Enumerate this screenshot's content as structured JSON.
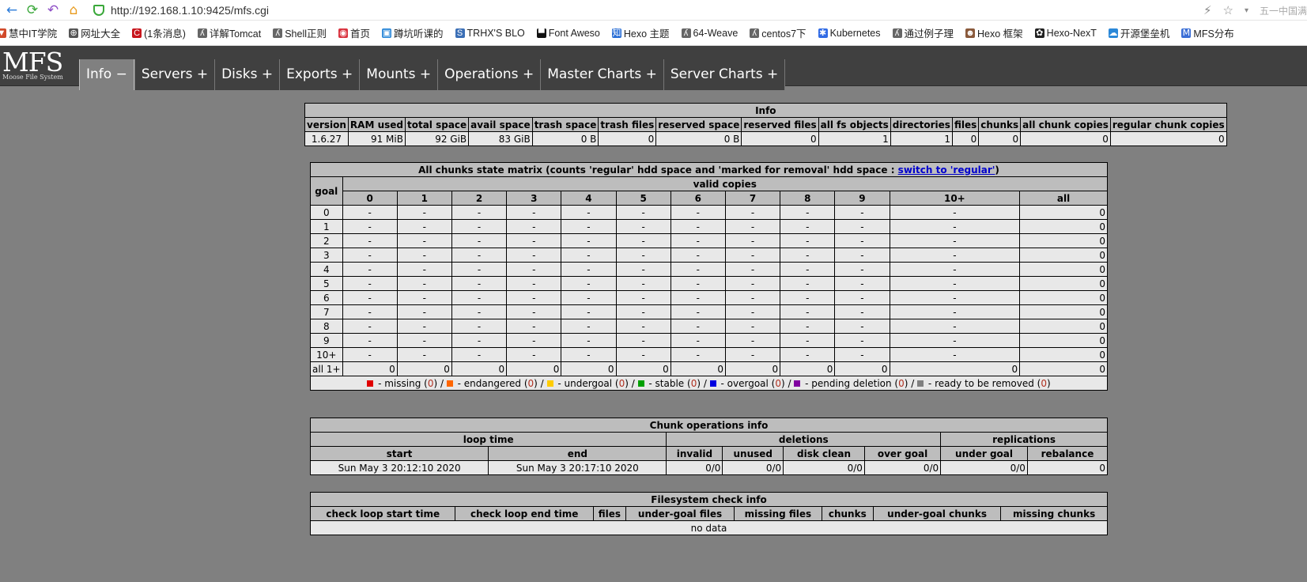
{
  "browser": {
    "url": "http://192.168.1.10:9425/mfs.cgi",
    "corner_text": "五一中国满"
  },
  "bookmarks": [
    {
      "label": "慧中IT学院",
      "color": "#d14a2b",
      "glyph": "▼"
    },
    {
      "label": "网址大全",
      "color": "#555555",
      "glyph": "⊕"
    },
    {
      "label": "(1条消息)",
      "color": "#c8161d",
      "glyph": "C"
    },
    {
      "label": "详解Tomcat",
      "color": "#666666",
      "glyph": "ʎ"
    },
    {
      "label": "Shell正则",
      "color": "#666666",
      "glyph": "ʎ"
    },
    {
      "label": "首页",
      "color": "#d9333f",
      "glyph": "◉"
    },
    {
      "label": "蹲坑听课的",
      "color": "#2b88d8",
      "glyph": "▣"
    },
    {
      "label": "TRHX'S BLO",
      "color": "#3b6fb6",
      "glyph": "S"
    },
    {
      "label": "Font Aweso",
      "color": "#111111",
      "glyph": "▀"
    },
    {
      "label": "Hexo 主题",
      "color": "#2a6fd6",
      "glyph": "知"
    },
    {
      "label": "64-Weave",
      "color": "#666666",
      "glyph": "ʎ"
    },
    {
      "label": "centos7下",
      "color": "#666666",
      "glyph": "ʎ"
    },
    {
      "label": "Kubernetes",
      "color": "#326ce5",
      "glyph": "✱"
    },
    {
      "label": "通过例子理",
      "color": "#666666",
      "glyph": "ʎ"
    },
    {
      "label": "Hexo 框架",
      "color": "#8a5a3c",
      "glyph": "☻"
    },
    {
      "label": "Hexo-NexT",
      "color": "#222222",
      "glyph": "✿"
    },
    {
      "label": "开源堡垒机",
      "color": "#2b88d8",
      "glyph": "☁"
    },
    {
      "label": "MFS分布",
      "color": "#3b6fd6",
      "glyph": "Ⅿ"
    }
  ],
  "logo": {
    "big": "MFS",
    "small": "Moose File System"
  },
  "menu": [
    "Info −",
    "Servers +",
    "Disks +",
    "Exports +",
    "Mounts +",
    "Operations +",
    "Master Charts +",
    "Server Charts +"
  ],
  "info": {
    "caption": "Info",
    "headers": [
      "version",
      "RAM used",
      "total space",
      "avail space",
      "trash space",
      "trash files",
      "reserved space",
      "reserved files",
      "all fs objects",
      "directories",
      "files",
      "chunks",
      "all chunk copies",
      "regular chunk copies"
    ],
    "values": [
      "1.6.27",
      "91 MiB",
      "92 GiB",
      "83 GiB",
      "0 B",
      "0",
      "0 B",
      "0",
      "1",
      "1",
      "0",
      "0",
      "0",
      "0"
    ]
  },
  "matrix": {
    "caption": "All chunks state matrix (counts 'regular' hdd space and 'marked for removal' hdd space : ",
    "switch_link": "switch to 'regular'",
    "caption_end": ")",
    "goal_header": "goal",
    "valid_header": "valid copies",
    "columns": [
      "0",
      "1",
      "2",
      "3",
      "4",
      "5",
      "6",
      "7",
      "8",
      "9",
      "10+",
      "all"
    ],
    "rows": [
      {
        "goal": "0",
        "cells": [
          "-",
          "-",
          "-",
          "-",
          "-",
          "-",
          "-",
          "-",
          "-",
          "-",
          "-",
          "0"
        ]
      },
      {
        "goal": "1",
        "cells": [
          "-",
          "-",
          "-",
          "-",
          "-",
          "-",
          "-",
          "-",
          "-",
          "-",
          "-",
          "0"
        ]
      },
      {
        "goal": "2",
        "cells": [
          "-",
          "-",
          "-",
          "-",
          "-",
          "-",
          "-",
          "-",
          "-",
          "-",
          "-",
          "0"
        ]
      },
      {
        "goal": "3",
        "cells": [
          "-",
          "-",
          "-",
          "-",
          "-",
          "-",
          "-",
          "-",
          "-",
          "-",
          "-",
          "0"
        ]
      },
      {
        "goal": "4",
        "cells": [
          "-",
          "-",
          "-",
          "-",
          "-",
          "-",
          "-",
          "-",
          "-",
          "-",
          "-",
          "0"
        ]
      },
      {
        "goal": "5",
        "cells": [
          "-",
          "-",
          "-",
          "-",
          "-",
          "-",
          "-",
          "-",
          "-",
          "-",
          "-",
          "0"
        ]
      },
      {
        "goal": "6",
        "cells": [
          "-",
          "-",
          "-",
          "-",
          "-",
          "-",
          "-",
          "-",
          "-",
          "-",
          "-",
          "0"
        ]
      },
      {
        "goal": "7",
        "cells": [
          "-",
          "-",
          "-",
          "-",
          "-",
          "-",
          "-",
          "-",
          "-",
          "-",
          "-",
          "0"
        ]
      },
      {
        "goal": "8",
        "cells": [
          "-",
          "-",
          "-",
          "-",
          "-",
          "-",
          "-",
          "-",
          "-",
          "-",
          "-",
          "0"
        ]
      },
      {
        "goal": "9",
        "cells": [
          "-",
          "-",
          "-",
          "-",
          "-",
          "-",
          "-",
          "-",
          "-",
          "-",
          "-",
          "0"
        ]
      },
      {
        "goal": "10+",
        "cells": [
          "-",
          "-",
          "-",
          "-",
          "-",
          "-",
          "-",
          "-",
          "-",
          "-",
          "-",
          "0"
        ]
      },
      {
        "goal": "all 1+",
        "cells": [
          "0",
          "0",
          "0",
          "0",
          "0",
          "0",
          "0",
          "0",
          "0",
          "0",
          "0",
          "0"
        ]
      }
    ],
    "legend": [
      {
        "color": "#e00000",
        "label": " - missing (",
        "count": "0",
        "sep": ") / "
      },
      {
        "color": "#ff6600",
        "label": " - endangered (",
        "count": "0",
        "sep": ") / "
      },
      {
        "color": "#ffcc00",
        "label": " - undergoal (",
        "count": "0",
        "sep": ") / "
      },
      {
        "color": "#00a000",
        "label": " - stable (",
        "count": "0",
        "sep": ") / "
      },
      {
        "color": "#0000e0",
        "label": " - overgoal (",
        "count": "0",
        "sep": ") / "
      },
      {
        "color": "#8000a0",
        "label": " - pending deletion (",
        "count": "0",
        "sep": ") / "
      },
      {
        "color": "#808080",
        "label": " - ready to be removed (",
        "count": "0",
        "sep": ")"
      }
    ]
  },
  "chunkops": {
    "caption": "Chunk operations info",
    "groups": [
      "loop time",
      "deletions",
      "replications"
    ],
    "headers": [
      "start",
      "end",
      "invalid",
      "unused",
      "disk clean",
      "over goal",
      "under goal",
      "rebalance"
    ],
    "values": [
      "Sun May 3 20:12:10 2020",
      "Sun May 3 20:17:10 2020",
      "0/0",
      "0/0",
      "0/0",
      "0/0",
      "0/0",
      "0"
    ]
  },
  "fscheck": {
    "caption": "Filesystem check info",
    "headers": [
      "check loop start time",
      "check loop end time",
      "files",
      "under-goal files",
      "missing files",
      "chunks",
      "under-goal chunks",
      "missing chunks"
    ],
    "empty": "no data"
  }
}
